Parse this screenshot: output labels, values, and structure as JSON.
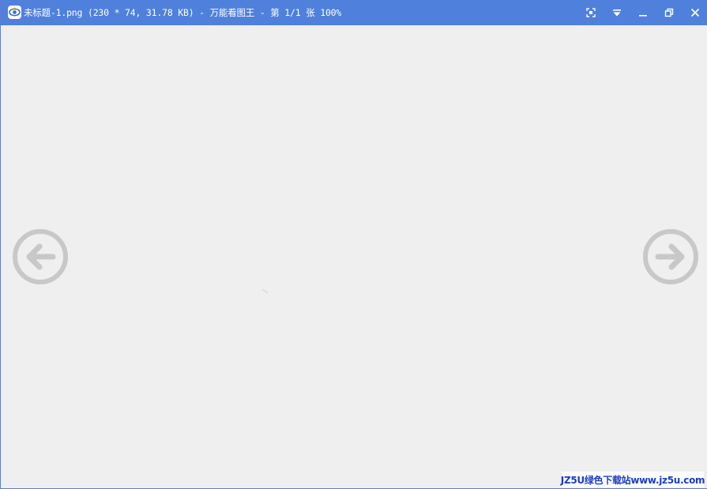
{
  "window": {
    "title": "未标题-1.png (230 * 74, 31.78 KB) - 万能看图王 - 第 1/1 张 100%",
    "app_icon": "eye-logo-icon",
    "controls": [
      {
        "name": "fullscreen-button",
        "icon": "fullscreen-icon"
      },
      {
        "name": "menu-dropdown-button",
        "icon": "dropdown-menu-icon"
      },
      {
        "name": "minimize-button",
        "icon": "minimize-icon"
      },
      {
        "name": "restore-button",
        "icon": "restore-icon"
      },
      {
        "name": "close-button",
        "icon": "close-icon"
      }
    ],
    "titlebar_color": "#4f80dc"
  },
  "viewer": {
    "background": "#efefef",
    "prev_icon": "arrow-left-circle-icon",
    "next_icon": "arrow-right-circle-icon",
    "arrow_color": "#c8c8c8"
  },
  "watermark": {
    "text": "JZ5U绿色下载站www.jz5u.com"
  }
}
